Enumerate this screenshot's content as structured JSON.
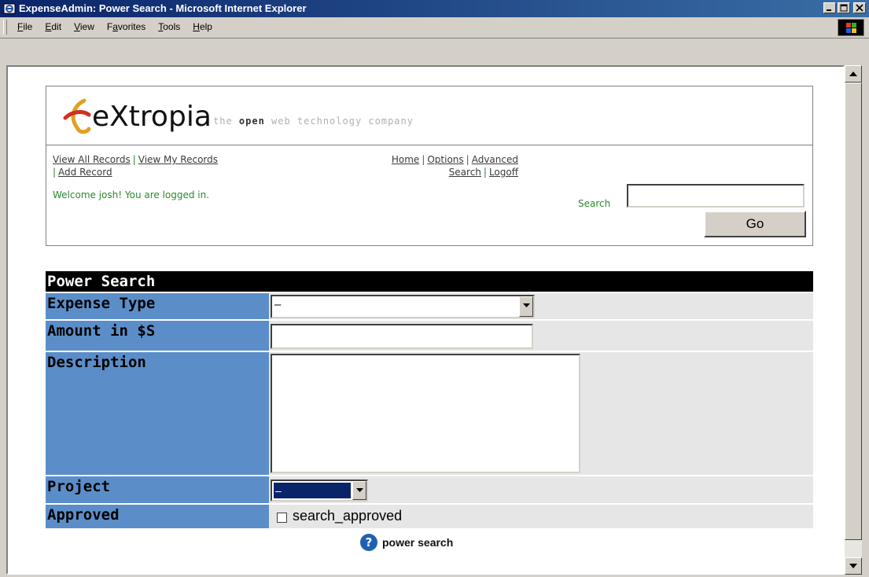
{
  "window": {
    "title": "ExpenseAdmin: Power Search - Microsoft Internet Explorer"
  },
  "menu": {
    "items": [
      {
        "label": "File",
        "accel": "F"
      },
      {
        "label": "Edit",
        "accel": "E"
      },
      {
        "label": "View",
        "accel": "V"
      },
      {
        "label": "Favorites",
        "accel": "a"
      },
      {
        "label": "Tools",
        "accel": "T"
      },
      {
        "label": "Help",
        "accel": "H"
      }
    ]
  },
  "brand": {
    "name": "eXtropia",
    "tagline_pre": "the ",
    "tagline_bold": "open",
    "tagline_post": " web technology company"
  },
  "nav": {
    "view_all": "View All Records",
    "view_my": "View My Records",
    "add_record": "Add Record",
    "home": "Home",
    "options": "Options",
    "advanced": "Advanced",
    "search": "Search",
    "logoff": "Logoff",
    "sep": "|"
  },
  "welcome": "Welcome josh! You are logged in.",
  "search": {
    "label": "Search",
    "value": "",
    "go_label": "Go"
  },
  "form": {
    "title": "Power Search",
    "fields": {
      "expense_type": {
        "label": "Expense Type",
        "value": "–"
      },
      "amount": {
        "label": "Amount in $S",
        "value": ""
      },
      "description": {
        "label": "Description",
        "value": ""
      },
      "project": {
        "label": "Project",
        "value": "–"
      },
      "approved": {
        "label": "Approved",
        "checkbox_label": "search_approved",
        "checked": false
      }
    },
    "help_label": "power search",
    "help_glyph": "?"
  },
  "colors": {
    "label_bg": "#5b8ec9",
    "row_bg": "#e6e6e6",
    "accent_green": "#2a8a2a",
    "header_bg": "#000000",
    "select_highlight": "#0a246a"
  }
}
